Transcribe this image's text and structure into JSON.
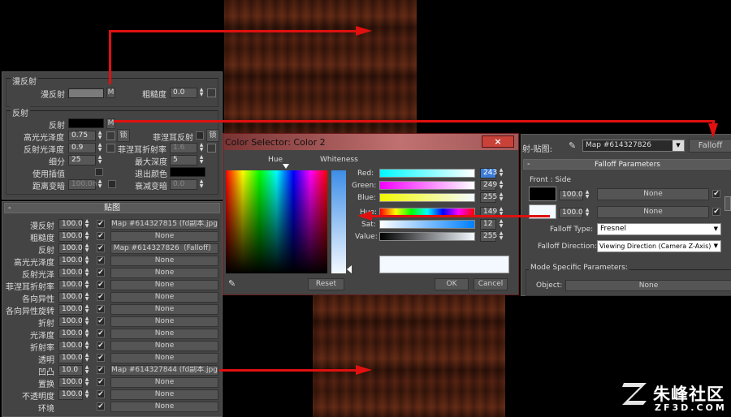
{
  "diffuse_group": {
    "title": "漫反射",
    "diffuse_label": "漫反射",
    "m_button": "M",
    "roughness_label": "粗糙度",
    "roughness_value": "0.0"
  },
  "reflect_group": {
    "title": "反射",
    "reflect_label": "反射",
    "m_button": "M",
    "hilight_gloss_label": "高光光泽度",
    "hilight_gloss_value": "0.75",
    "lock_label": "L",
    "fresnel_label": "菲涅耳反射",
    "lock2_label": "锁",
    "refl_gloss_label": "反射光泽度",
    "refl_gloss_value": "0.9",
    "fresnel_ior_label": "菲涅耳折射率",
    "fresnel_ior_value": "1.6",
    "subdivs_label": "细分",
    "subdivs_value": "25",
    "max_depth_label": "最大深度",
    "max_depth_value": "5",
    "use_interp_label": "使用插值",
    "exit_color_label": "退出颜色",
    "dim_dist_label": "距离变暗",
    "dim_dist_value": "100.0n",
    "dim_falloff_label": "衰减变暗",
    "dim_falloff_value": "0.0"
  },
  "maps": {
    "title": "贴图",
    "rows": [
      {
        "label": "漫反射",
        "amount": "100.0",
        "checked": true,
        "map": "Map #614327815 (fd副本.jpg)"
      },
      {
        "label": "粗糙度",
        "amount": "100.0",
        "checked": true,
        "map": "None"
      },
      {
        "label": "反射",
        "amount": "100.0",
        "checked": true,
        "map": "Map #614327826（Falloff）"
      },
      {
        "label": "高光光泽度",
        "amount": "100.0",
        "checked": true,
        "map": "None"
      },
      {
        "label": "反射光泽",
        "amount": "100.0",
        "checked": true,
        "map": "None"
      },
      {
        "label": "菲涅耳折射率",
        "amount": "100.0",
        "checked": true,
        "map": "None"
      },
      {
        "label": "各向异性",
        "amount": "100.0",
        "checked": true,
        "map": "None"
      },
      {
        "label": "各向异性旋转",
        "amount": "100.0",
        "checked": true,
        "map": "None"
      },
      {
        "label": "折射",
        "amount": "100.0",
        "checked": true,
        "map": "None"
      },
      {
        "label": "光泽度",
        "amount": "100.0",
        "checked": true,
        "map": "None"
      },
      {
        "label": "折射率",
        "amount": "100.0",
        "checked": true,
        "map": "None"
      },
      {
        "label": "透明",
        "amount": "100.0",
        "checked": true,
        "map": "None"
      },
      {
        "label": "凹凸",
        "amount": "10.0",
        "checked": true,
        "map": "Map #614327844 (fd副本.jpg)"
      },
      {
        "label": "置换",
        "amount": "100.0",
        "checked": true,
        "map": "None"
      },
      {
        "label": "不透明度",
        "amount": "100.0",
        "checked": true,
        "map": "None"
      },
      {
        "label": "环境",
        "amount": "",
        "checked": true,
        "map": "None"
      }
    ]
  },
  "color_selector": {
    "title": "Color Selector: Color 2",
    "hue_label": "Hue",
    "whiteness_label": "Whiteness",
    "red_label": "Red:",
    "red_value": "243",
    "green_label": "Green:",
    "green_value": "249",
    "blue_label": "Blue:",
    "blue_value": "255",
    "hue2_label": "Hue:",
    "hue2_value": "149",
    "sat_label": "Sat:",
    "sat_value": "12",
    "value_label": "Value:",
    "value_value": "255",
    "reset_label": "Reset",
    "ok_label": "OK",
    "cancel_label": "Cancel",
    "preview_color": "#f3f9ff"
  },
  "falloff": {
    "map_label": "射-贴图:",
    "map_name": "Map #614327826",
    "map_type_button": "Falloff",
    "params_title": "Falloff Parameters",
    "front_side_label": "Front : Side",
    "front_amount": "100.0",
    "front_map": "None",
    "side_amount": "100.0",
    "side_map": "None",
    "falloff_type_label": "Falloff Type:",
    "falloff_type_value": "Fresnel",
    "falloff_dir_label": "Falloff Direction:",
    "falloff_dir_value": "Viewing Direction (Camera Z-Axis)",
    "mode_specific_label": "Mode Specific Parameters:",
    "object_label": "Object:",
    "object_value": "None",
    "minus_sign": "-"
  },
  "watermark": {
    "brand": "朱峰社区",
    "site": "ZF3D.COM"
  },
  "colors": {
    "panel": "#444444",
    "arrow": "#e01010",
    "selection": "#3d7bd6"
  }
}
